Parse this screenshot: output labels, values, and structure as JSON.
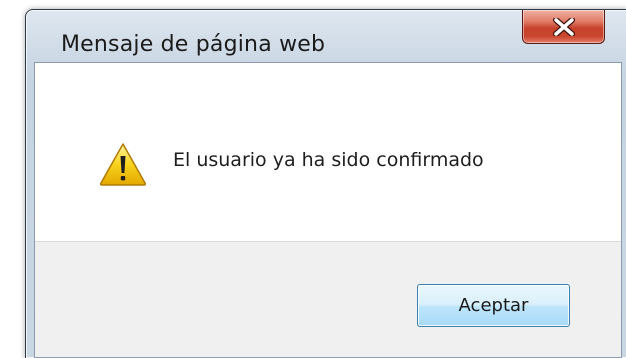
{
  "dialog": {
    "title": "Mensaje de página web",
    "message": "El usuario ya ha sido confirmado",
    "icon": "warning-icon",
    "ok_button": "Aceptar",
    "close_icon": "close-icon"
  },
  "colors": {
    "close_button": "#c7412b",
    "ok_button_border": "#3c7fb1",
    "warning_yellow": "#f5c400"
  }
}
